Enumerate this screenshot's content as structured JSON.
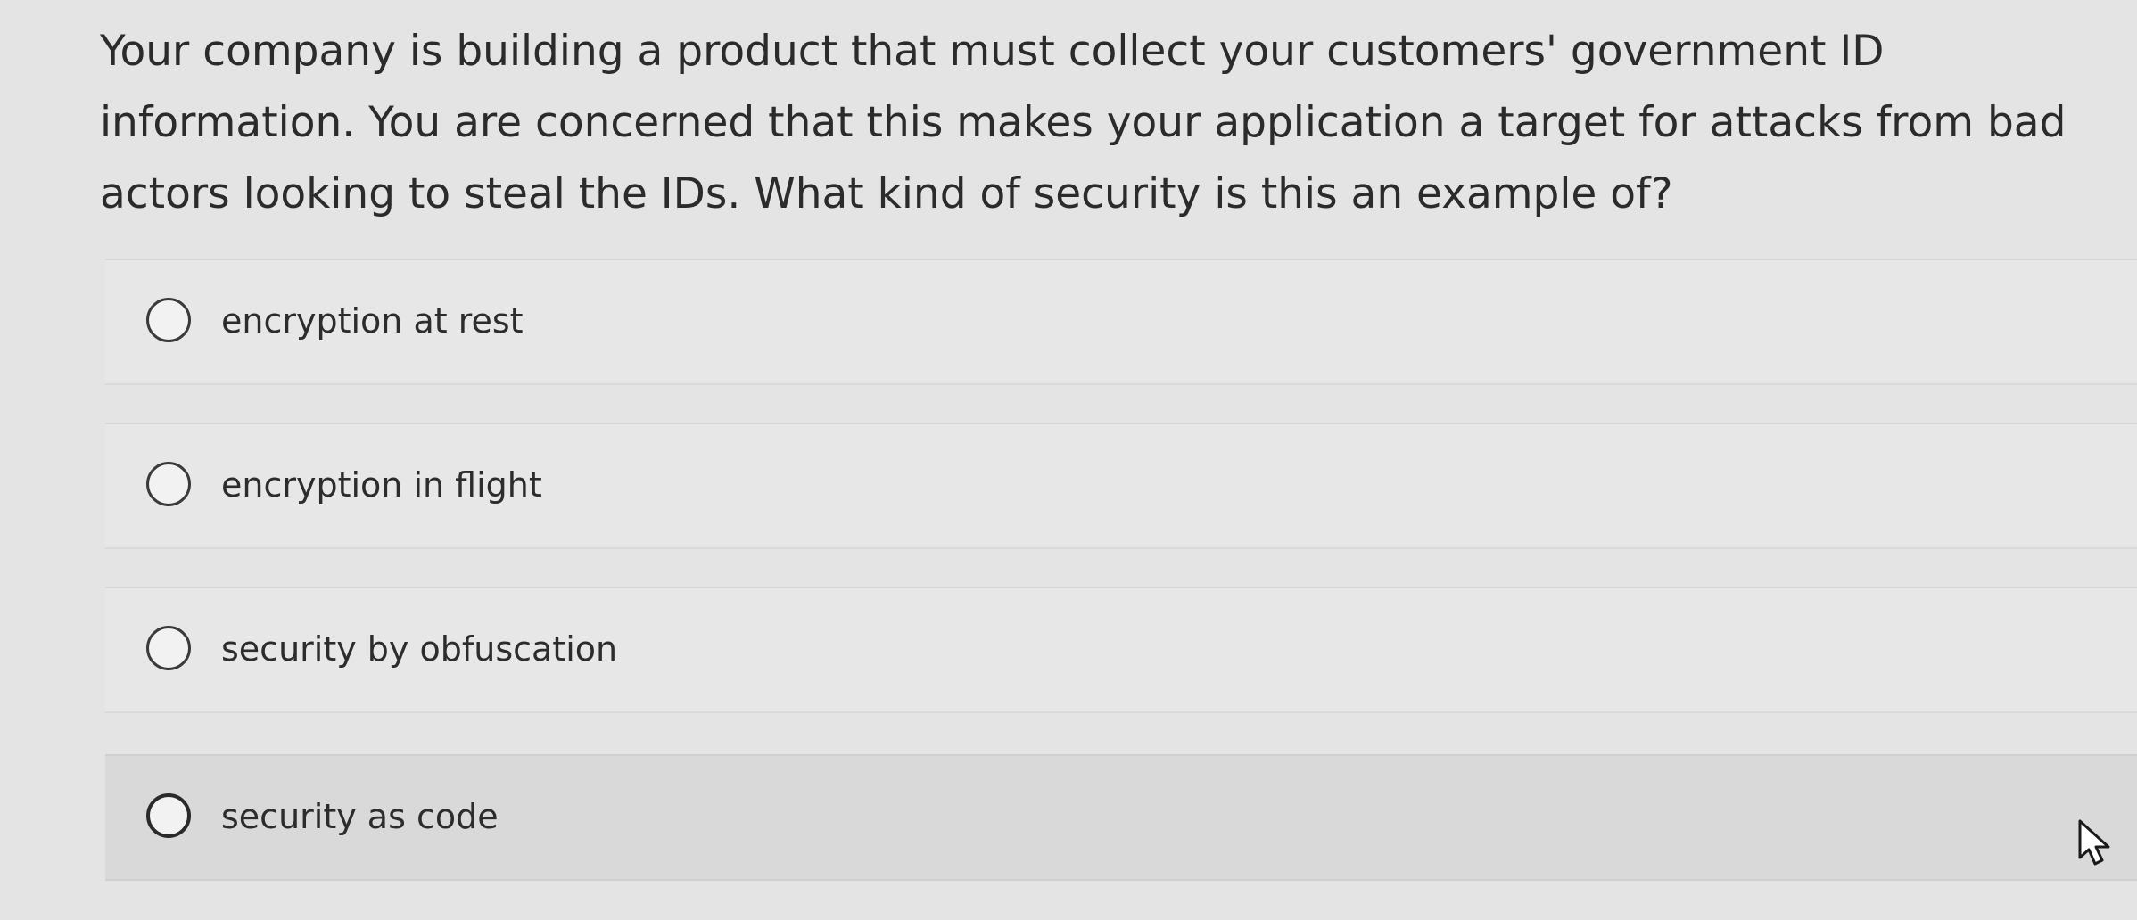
{
  "question": {
    "text": "Your company is building a product that must collect your customers' government ID information. You are concerned that this makes your application a target for attacks from bad actors looking to steal the IDs. What kind of security is this an example of?"
  },
  "options": [
    {
      "label": "encryption at rest",
      "selected": false
    },
    {
      "label": "encryption in flight",
      "selected": false
    },
    {
      "label": "security by obfuscation",
      "selected": false
    },
    {
      "label": "security as code",
      "selected": false,
      "hovered": true
    }
  ],
  "icons": {
    "radio": "radio-button-icon",
    "cursor": "mouse-pointer-icon"
  }
}
